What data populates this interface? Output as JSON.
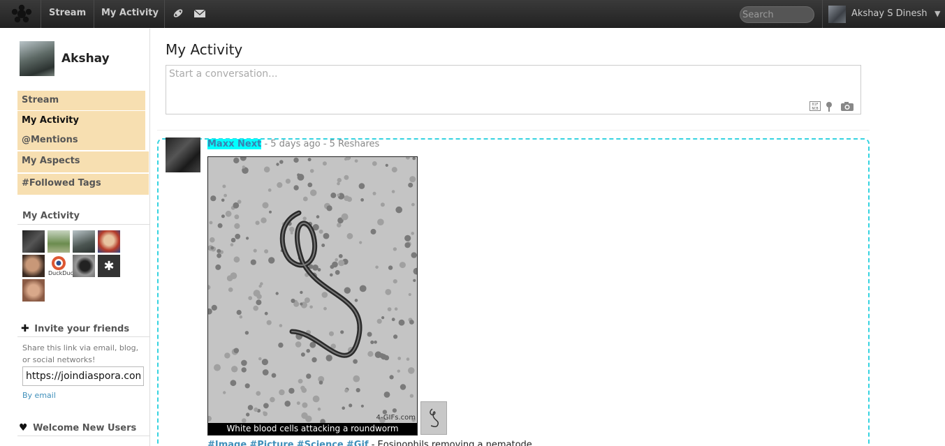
{
  "topbar": {
    "stream_label": "Stream",
    "my_activity_label": "My Activity",
    "search_placeholder": "Search",
    "user_name": "Akshay S Dinesh"
  },
  "sidebar": {
    "profile_name": "Akshay",
    "nav_items": [
      {
        "label": "Stream"
      },
      {
        "label": "My Activity"
      },
      {
        "label": "@Mentions"
      },
      {
        "label": "My Aspects"
      },
      {
        "label": "#Followed Tags"
      }
    ],
    "activity_heading": "My Activity",
    "thumb_caption": "DuckDuc",
    "invite": {
      "heading": "Invite your friends",
      "description": "Share this link via email, blog, or social networks!",
      "link_value": "https://joindiaspora.com/",
      "by_email": "By email"
    },
    "welcome_heading": "Welcome New Users"
  },
  "main": {
    "page_title": "My Activity",
    "publisher_placeholder": "Start a conversation..."
  },
  "post": {
    "author": "Maxx Next",
    "meta": "- 5 days ago - 5 Reshares",
    "gif_caption": "White blood cells attacking a roundworm",
    "gif_watermark": "4-GIFs.com",
    "tags": [
      "#Image",
      "#Picture",
      "#Science",
      "#Gif"
    ],
    "text": " - Eosinophils removing a nematode"
  },
  "colors": {
    "topbar_bg": "#2a2a2a",
    "sidebar_item_bg": "#f7dfb1",
    "link": "#3f8fba",
    "highlight": "#00ffff",
    "post_border": "#35d3e0"
  },
  "icons": [
    "diaspora-asterisk-icon",
    "notifications-icon",
    "mail-icon",
    "plus-icon",
    "heart-icon",
    "markdown-icon",
    "location-pin-icon",
    "camera-icon",
    "dropdown-caret-icon"
  ]
}
